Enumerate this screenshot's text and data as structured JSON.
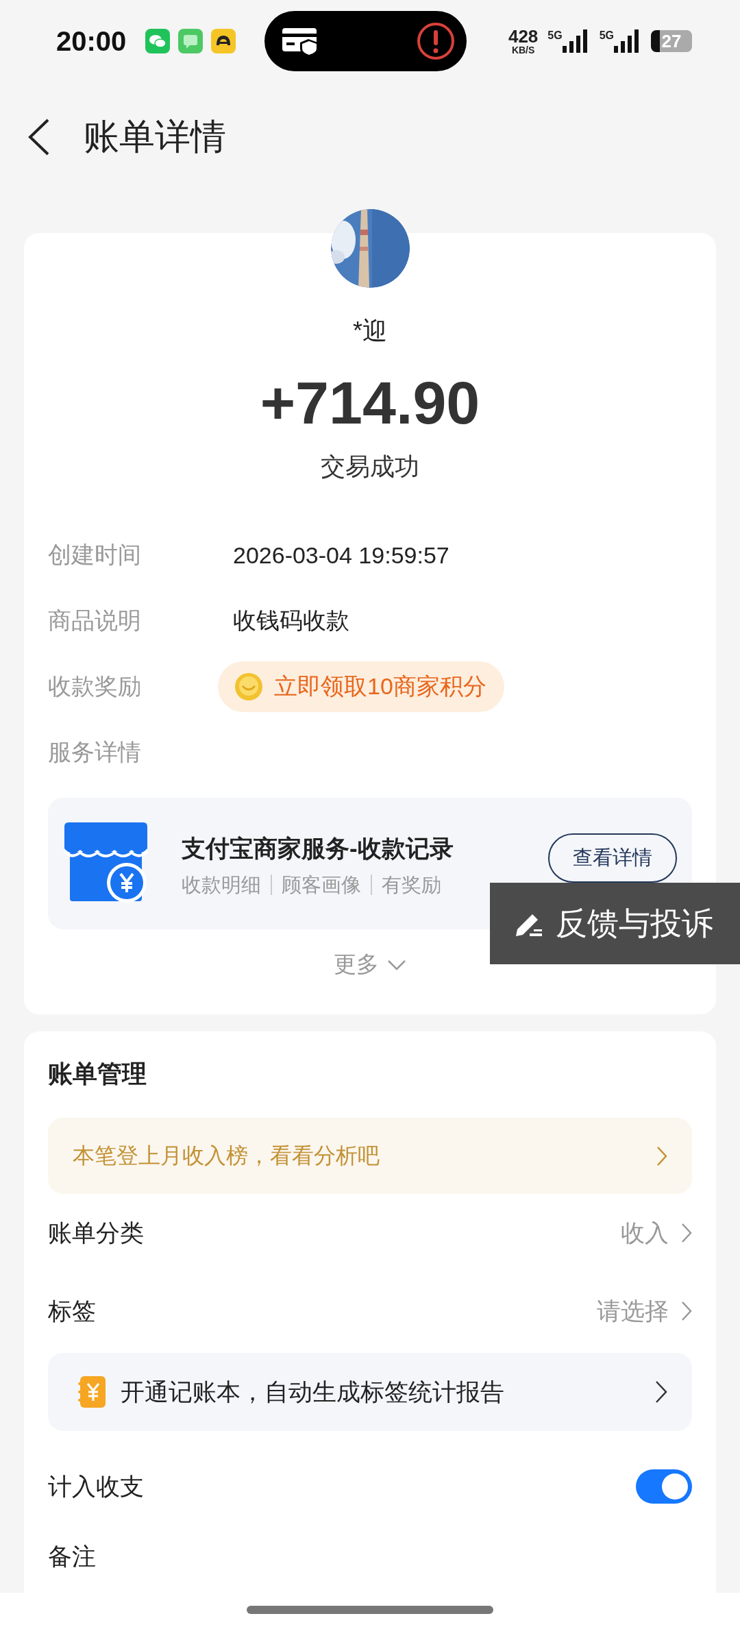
{
  "status_bar": {
    "time": "20:00",
    "net_speed": "428",
    "net_unit": "KB/S",
    "signals": [
      {
        "label": "5G"
      },
      {
        "label": "5G"
      }
    ],
    "battery": "27"
  },
  "header": {
    "title": "账单详情"
  },
  "summary": {
    "name": "*迎",
    "amount": "+714.90",
    "status": "交易成功"
  },
  "details": [
    {
      "kind": "text",
      "label": "创建时间",
      "value": "2026-03-04 19:59:57"
    },
    {
      "kind": "text",
      "label": "商品说明",
      "value": "收钱码收款"
    },
    {
      "kind": "reward",
      "label": "收款奖励",
      "value": "立即领取10商家积分"
    },
    {
      "kind": "heading",
      "label": "服务详情"
    }
  ],
  "service": {
    "title": "支付宝商家服务-收款记录",
    "tags": [
      "收款明细",
      "顾客画像",
      "有奖励"
    ],
    "button": "查看详情"
  },
  "more": "更多",
  "management": {
    "title": "账单管理",
    "banner": "本笔登上月收入榜，看看分析吧",
    "rows": [
      {
        "kind": "select",
        "label": "账单分类",
        "value": "收入"
      },
      {
        "kind": "select",
        "label": "标签",
        "value": "请选择"
      },
      {
        "kind": "promo",
        "text": "开通记账本，自动生成标签统计报告"
      },
      {
        "kind": "toggle",
        "label": "计入收支",
        "on": true
      },
      {
        "kind": "plain",
        "label": "备注"
      }
    ]
  },
  "feedback": {
    "label": "反馈与投诉"
  }
}
